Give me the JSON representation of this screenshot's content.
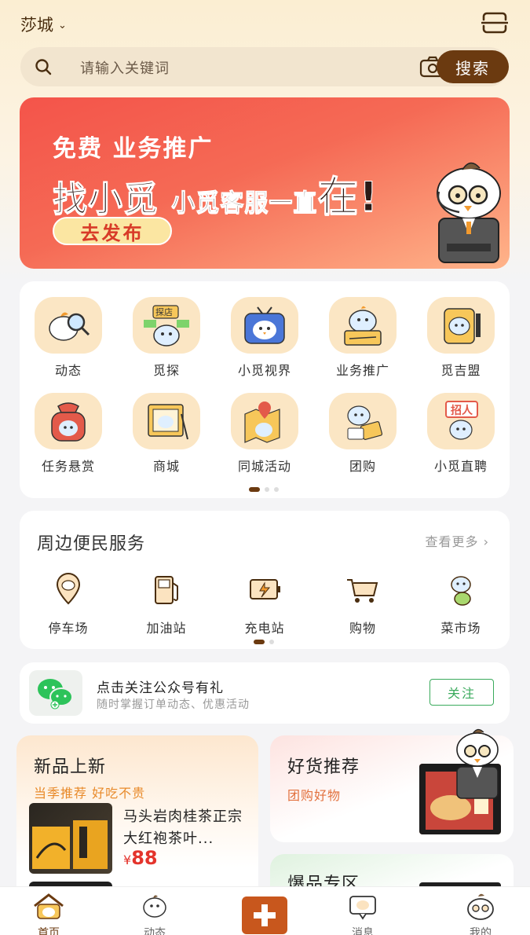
{
  "header": {
    "city": "莎城",
    "search_placeholder": "请输入关键词",
    "search_button": "搜索"
  },
  "banner": {
    "line1": "免费 业务推广",
    "line2_a": "找小觅",
    "line2_b": "小觅客服一直",
    "line2_c": "在!",
    "cta": "去发布"
  },
  "grid": {
    "items": [
      {
        "label": "动态",
        "icon": "magnifier-mascot-icon"
      },
      {
        "label": "觅探",
        "icon": "store-explore-icon"
      },
      {
        "label": "小觅视界",
        "icon": "tv-mascot-icon"
      },
      {
        "label": "业务推广",
        "icon": "promote-mascot-icon"
      },
      {
        "label": "觅吉盟",
        "icon": "alliance-mascot-icon"
      },
      {
        "label": "任务悬赏",
        "icon": "reward-bag-icon"
      },
      {
        "label": "商城",
        "icon": "shop-board-icon"
      },
      {
        "label": "同城活动",
        "icon": "map-pin-icon"
      },
      {
        "label": "团购",
        "icon": "group-buy-icon"
      },
      {
        "label": "小觅直聘",
        "icon": "recruit-icon"
      }
    ]
  },
  "services": {
    "title": "周边便民服务",
    "more": "查看更多",
    "items": [
      {
        "label": "停车场",
        "icon": "parking-icon"
      },
      {
        "label": "加油站",
        "icon": "gas-station-icon"
      },
      {
        "label": "充电站",
        "icon": "charging-icon"
      },
      {
        "label": "购物",
        "icon": "shopping-cart-icon"
      },
      {
        "label": "菜市场",
        "icon": "market-icon"
      }
    ]
  },
  "wechat": {
    "title": "点击关注公众号有礼",
    "subtitle": "随时掌握订单动态、优惠活动",
    "follow": "关注"
  },
  "new_arrivals": {
    "title": "新品上新",
    "subtitle": "当季推荐 好吃不贵",
    "product_name": "马头岩肉桂茶正宗大红袍茶叶...",
    "price_symbol": "¥",
    "price": "88"
  },
  "good_picks": {
    "title": "好货推荐",
    "subtitle": "团购好物"
  },
  "hot_zone": {
    "title": "爆品专区"
  },
  "tabbar": {
    "items": [
      {
        "label": "首页",
        "icon": "home-icon"
      },
      {
        "label": "动态",
        "icon": "feed-icon"
      },
      {
        "label": "",
        "icon": "plus-icon"
      },
      {
        "label": "消息",
        "icon": "message-icon"
      },
      {
        "label": "我的",
        "icon": "profile-icon"
      }
    ]
  },
  "colors": {
    "brand": "#6b3a10",
    "accent": "#c8571d",
    "price": "#e4342c",
    "wechat_green": "#3aaa5c"
  }
}
